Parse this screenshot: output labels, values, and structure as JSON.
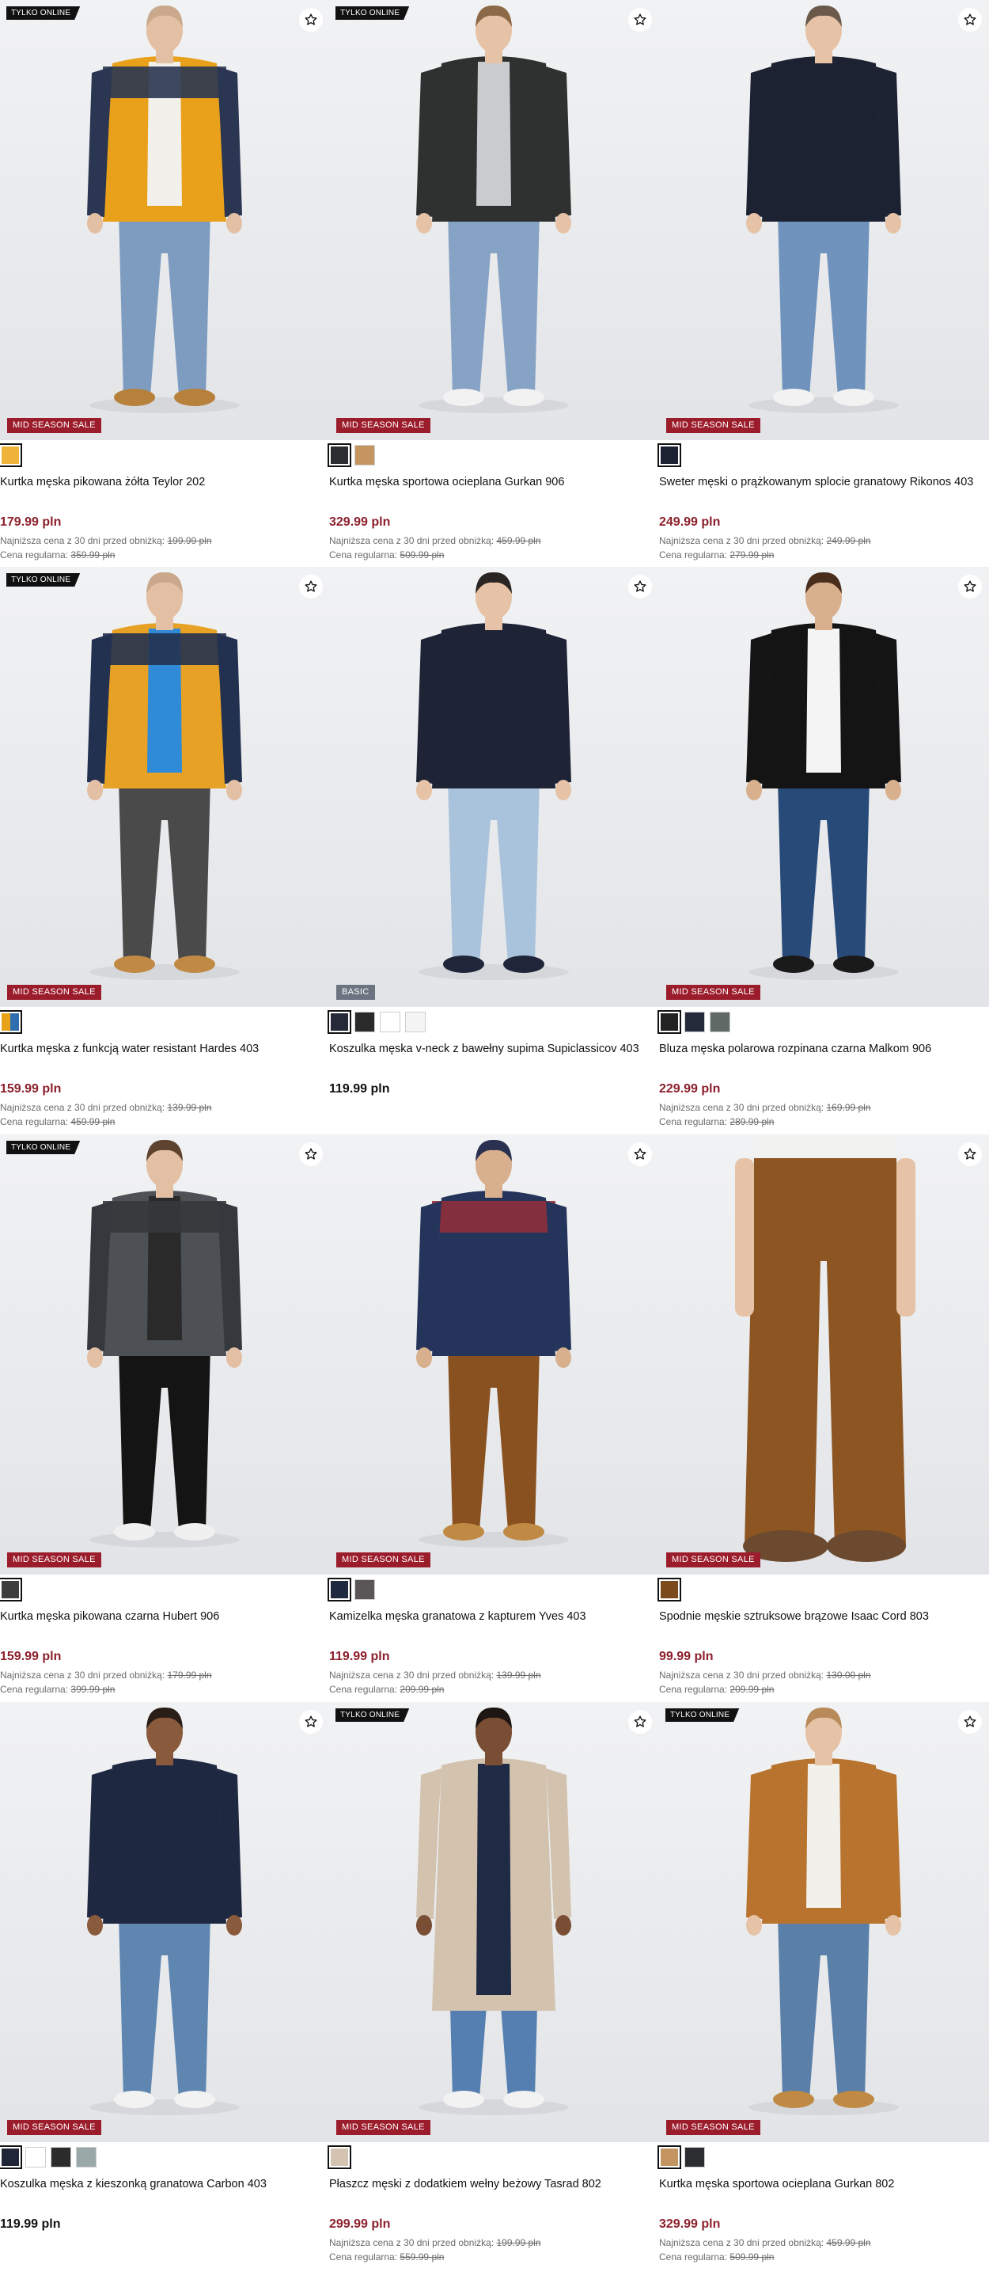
{
  "products": [
    {
      "online": "TYLKO ONLINE",
      "label": "MID SEASON SALE",
      "label_type": "sale",
      "name": "Kurtka męska pikowana żółta Teylor 202",
      "price": "179.99 pln",
      "price_type": "sale",
      "lowest_prefix": "Najniższa cena z 30 dni przed obniżką:",
      "lowest_value": "199.99 pln",
      "regular_prefix": "Cena regularna:",
      "regular_value": "359.99 pln",
      "swatches": [
        "#efb33a"
      ],
      "selected": 0,
      "photo": {
        "bg": "#eceef0",
        "top": "#e9a11b",
        "top2": "#2a3652",
        "inner": "#f2f0ea",
        "pants": "#7e9cc0",
        "shoes": "#b7813c",
        "skin": "#e3bfa3",
        "hair": "#c9a88c"
      }
    },
    {
      "online": "TYLKO ONLINE",
      "label": "MID SEASON SALE",
      "label_type": "sale",
      "name": "Kurtka męska sportowa ocieplana Gurkan 906",
      "price": "329.99 pln",
      "price_type": "sale",
      "lowest_prefix": "Najniższa cena z 30 dni przed obniżką:",
      "lowest_value": "459.99 pln",
      "regular_prefix": "Cena regularna:",
      "regular_value": "509.99 pln",
      "swatches": [
        "#2b2d31",
        "#c49461"
      ],
      "selected": 0,
      "photo": {
        "bg": "#eceef0",
        "top": "#2e312f",
        "top2": "#2e312f",
        "inner": "#c9cbcf",
        "pants": "#86a2c4",
        "shoes": "#f2f2f2",
        "skin": "#e6c3a6",
        "hair": "#8c6a48"
      }
    },
    {
      "online": "",
      "label": "MID SEASON SALE",
      "label_type": "sale",
      "name": "Sweter męski o prążkowanym splocie granatowy Rikonos 403",
      "price": "249.99 pln",
      "price_type": "sale",
      "lowest_prefix": "Najniższa cena z 30 dni przed obniżką:",
      "lowest_value": "249.99 pln",
      "regular_prefix": "Cena regularna:",
      "regular_value": "279.99 pln",
      "swatches": [
        "#1d2233"
      ],
      "selected": 0,
      "photo": {
        "bg": "#eceef0",
        "top": "#1d2233",
        "top2": "#1d2233",
        "inner": "#1d2233",
        "pants": "#6f93bd",
        "shoes": "#f2f2f2",
        "skin": "#e6c3a6",
        "hair": "#6b5a4a"
      }
    },
    {
      "online": "TYLKO ONLINE",
      "label": "MID SEASON SALE",
      "label_type": "sale",
      "name": "Kurtka męska z funkcją water resistant Hardes 403",
      "price": "159.99 pln",
      "price_type": "sale",
      "lowest_prefix": "Najniższa cena z 30 dni przed obniżką:",
      "lowest_value": "139.99 pln",
      "regular_prefix": "Cena regularna:",
      "regular_value": "459.99 pln",
      "swatches": [
        "split"
      ],
      "selected": 0,
      "photo": {
        "bg": "#eceef0",
        "top": "#e7a124",
        "top2": "#233150",
        "inner": "#2f8ad8",
        "pants": "#4a4a4a",
        "shoes": "#c08a45",
        "skin": "#e3bfa3",
        "hair": "#c9a88c"
      }
    },
    {
      "online": "",
      "label": "BASIC",
      "label_type": "basic",
      "name": "Koszulka męska v-neck z bawełny supima Supiclassicov 403",
      "price": "119.99 pln",
      "price_type": "regular",
      "lowest_prefix": "",
      "lowest_value": "",
      "regular_prefix": "",
      "regular_value": "",
      "swatches": [
        "#262a38",
        "#2a2a2a",
        "#ffffff",
        "#f4f4f4"
      ],
      "selected": 0,
      "photo": {
        "bg": "#eceef0",
        "top": "#1f2336",
        "top2": "#1f2336",
        "inner": "#1f2336",
        "pants": "#a9c3dc",
        "shoes": "#20263a",
        "skin": "#e6c3a6",
        "hair": "#2a2522"
      }
    },
    {
      "online": "",
      "label": "MID SEASON SALE",
      "label_type": "sale",
      "name": "Bluza męska polarowa rozpinana czarna Malkom 906",
      "price": "229.99 pln",
      "price_type": "sale",
      "lowest_prefix": "Najniższa cena z 30 dni przed obniżką:",
      "lowest_value": "169.99 pln",
      "regular_prefix": "Cena regularna:",
      "regular_value": "289.99 pln",
      "swatches": [
        "#222222",
        "#252a3a",
        "#5f6a66"
      ],
      "selected": 0,
      "photo": {
        "bg": "#eceef0",
        "top": "#141414",
        "top2": "#141414",
        "inner": "#f4f4f4",
        "pants": "#284a78",
        "shoes": "#1a1a1a",
        "skin": "#d8b08e",
        "hair": "#4a2e1c"
      }
    },
    {
      "online": "TYLKO ONLINE",
      "label": "MID SEASON SALE",
      "label_type": "sale",
      "name": "Kurtka męska pikowana czarna Hubert 906",
      "price": "159.99 pln",
      "price_type": "sale",
      "lowest_prefix": "Najniższa cena z 30 dni przed obniżką:",
      "lowest_value": "179.99 pln",
      "regular_prefix": "Cena regularna:",
      "regular_value": "399.99 pln",
      "swatches": [
        "#3d3d3d"
      ],
      "selected": 0,
      "photo": {
        "bg": "#eceef0",
        "top": "#4d5054",
        "top2": "#35383c",
        "inner": "#2a2a2a",
        "pants": "#141414",
        "shoes": "#f0f0f0",
        "skin": "#e3bfa3",
        "hair": "#5e4330"
      }
    },
    {
      "online": "",
      "label": "MID SEASON SALE",
      "label_type": "sale",
      "name": "Kamizelka męska granatowa z kapturem Yves 403",
      "price": "119.99 pln",
      "price_type": "sale",
      "lowest_prefix": "Najniższa cena z 30 dni przed obniżką:",
      "lowest_value": "139.99 pln",
      "regular_prefix": "Cena regularna:",
      "regular_value": "209.99 pln",
      "swatches": [
        "#1e2940",
        "#5a5657"
      ],
      "selected": 0,
      "photo": {
        "bg": "#eceef0",
        "top": "#24345a",
        "top2": "#8f2f3a",
        "inner": "#24345a",
        "pants": "#8a5120",
        "shoes": "#c08a45",
        "skin": "#d8b08e",
        "hair": "#2a3150"
      }
    },
    {
      "online": "",
      "label": "MID SEASON SALE",
      "label_type": "sale",
      "name": "Spodnie męskie sztruksowe brązowe Isaac Cord 803",
      "price": "99.99 pln",
      "price_type": "sale",
      "lowest_prefix": "Najniższa cena z 30 dni przed obniżką:",
      "lowest_value": "130.00 pln",
      "regular_prefix": "Cena regularna:",
      "regular_value": "209.99 pln",
      "swatches": [
        "#7a4a1c"
      ],
      "selected": 0,
      "photo": {
        "bg": "#eceef0",
        "top": "#f2f2f0",
        "top2": "#f2f2f0",
        "inner": "#f2f2f0",
        "pants": "#8c5521",
        "shoes": "#6b4a30",
        "skin": "#e6c3a6",
        "hair": "#e6c3a6"
      }
    },
    {
      "online": "",
      "label": "MID SEASON SALE",
      "label_type": "sale",
      "name": "Koszulka męska z kieszonką granatowa Carbon 403",
      "price": "119.99 pln",
      "price_type": "regular",
      "lowest_prefix": "",
      "lowest_value": "",
      "regular_prefix": "",
      "regular_value": "",
      "swatches": [
        "#202638",
        "#ffffff",
        "#2b2b2b",
        "#9aa8a8"
      ],
      "selected": 0,
      "photo": {
        "bg": "#eceef0",
        "top": "#1f2841",
        "top2": "#1f2841",
        "inner": "#1f2841",
        "pants": "#5e86b0",
        "shoes": "#f2f2f2",
        "skin": "#8a5a3c",
        "hair": "#2a1e18"
      }
    },
    {
      "online": "TYLKO ONLINE",
      "label": "MID SEASON SALE",
      "label_type": "sale",
      "name": "Płaszcz męski z dodatkiem wełny beżowy Tasrad 802",
      "price": "299.99 pln",
      "price_type": "sale",
      "lowest_prefix": "Najniższa cena z 30 dni przed obniżką:",
      "lowest_value": "199.99 pln",
      "regular_prefix": "Cena regularna:",
      "regular_value": "559.99 pln",
      "swatches": [
        "#d4c3b0"
      ],
      "selected": 0,
      "photo": {
        "bg": "#eceef0",
        "top": "#d2c2ae",
        "top2": "#d2c2ae",
        "inner": "#1f2a45",
        "pants": "#557fb0",
        "shoes": "#f2f2f2",
        "skin": "#7a4e34",
        "hair": "#1e1612"
      }
    },
    {
      "online": "TYLKO ONLINE",
      "label": "MID SEASON SALE",
      "label_type": "sale",
      "name": "Kurtka męska sportowa ocieplana Gurkan 802",
      "price": "329.99 pln",
      "price_type": "sale",
      "lowest_prefix": "Najniższa cena z 30 dni przed obniżką:",
      "lowest_value": "459.99 pln",
      "regular_prefix": "Cena regularna:",
      "regular_value": "509.99 pln",
      "swatches": [
        "#c49461",
        "#2b2d31"
      ],
      "selected": 0,
      "photo": {
        "bg": "#eceef0",
        "top": "#b8732e",
        "top2": "#b8732e",
        "inner": "#f2f0ea",
        "pants": "#5a7fa8",
        "shoes": "#c08a45",
        "skin": "#e6c3a6",
        "hair": "#b88a5a"
      }
    }
  ],
  "icons": {
    "favorite": "star-outline-icon"
  },
  "colors": {
    "sale_price": "#8c1f2c",
    "sale_label": "#9b1c2b",
    "basic_label": "#6b7480",
    "online_badge": "#111111"
  }
}
